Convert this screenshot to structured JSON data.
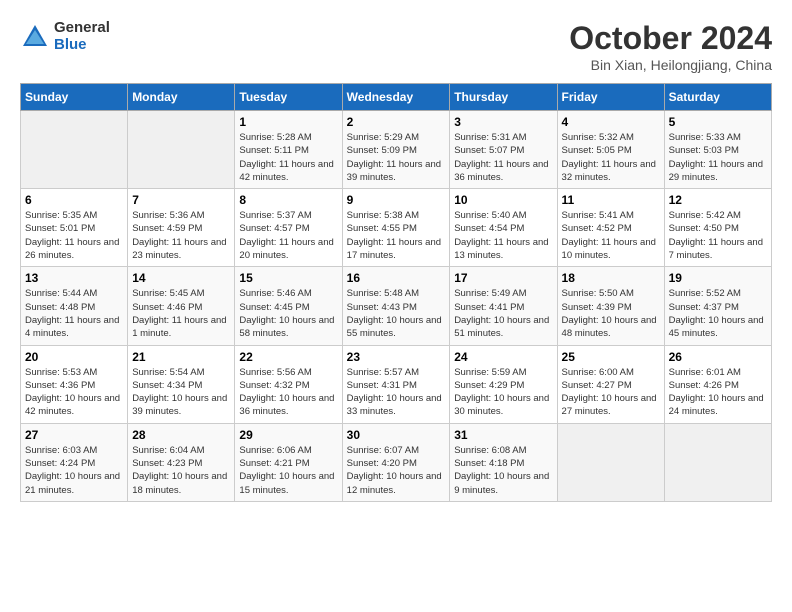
{
  "header": {
    "logo_general": "General",
    "logo_blue": "Blue",
    "month": "October 2024",
    "location": "Bin Xian, Heilongjiang, China"
  },
  "days_of_week": [
    "Sunday",
    "Monday",
    "Tuesday",
    "Wednesday",
    "Thursday",
    "Friday",
    "Saturday"
  ],
  "weeks": [
    [
      {
        "day": "",
        "info": ""
      },
      {
        "day": "",
        "info": ""
      },
      {
        "day": "1",
        "info": "Sunrise: 5:28 AM\nSunset: 5:11 PM\nDaylight: 11 hours and 42 minutes."
      },
      {
        "day": "2",
        "info": "Sunrise: 5:29 AM\nSunset: 5:09 PM\nDaylight: 11 hours and 39 minutes."
      },
      {
        "day": "3",
        "info": "Sunrise: 5:31 AM\nSunset: 5:07 PM\nDaylight: 11 hours and 36 minutes."
      },
      {
        "day": "4",
        "info": "Sunrise: 5:32 AM\nSunset: 5:05 PM\nDaylight: 11 hours and 32 minutes."
      },
      {
        "day": "5",
        "info": "Sunrise: 5:33 AM\nSunset: 5:03 PM\nDaylight: 11 hours and 29 minutes."
      }
    ],
    [
      {
        "day": "6",
        "info": "Sunrise: 5:35 AM\nSunset: 5:01 PM\nDaylight: 11 hours and 26 minutes."
      },
      {
        "day": "7",
        "info": "Sunrise: 5:36 AM\nSunset: 4:59 PM\nDaylight: 11 hours and 23 minutes."
      },
      {
        "day": "8",
        "info": "Sunrise: 5:37 AM\nSunset: 4:57 PM\nDaylight: 11 hours and 20 minutes."
      },
      {
        "day": "9",
        "info": "Sunrise: 5:38 AM\nSunset: 4:55 PM\nDaylight: 11 hours and 17 minutes."
      },
      {
        "day": "10",
        "info": "Sunrise: 5:40 AM\nSunset: 4:54 PM\nDaylight: 11 hours and 13 minutes."
      },
      {
        "day": "11",
        "info": "Sunrise: 5:41 AM\nSunset: 4:52 PM\nDaylight: 11 hours and 10 minutes."
      },
      {
        "day": "12",
        "info": "Sunrise: 5:42 AM\nSunset: 4:50 PM\nDaylight: 11 hours and 7 minutes."
      }
    ],
    [
      {
        "day": "13",
        "info": "Sunrise: 5:44 AM\nSunset: 4:48 PM\nDaylight: 11 hours and 4 minutes."
      },
      {
        "day": "14",
        "info": "Sunrise: 5:45 AM\nSunset: 4:46 PM\nDaylight: 11 hours and 1 minute."
      },
      {
        "day": "15",
        "info": "Sunrise: 5:46 AM\nSunset: 4:45 PM\nDaylight: 10 hours and 58 minutes."
      },
      {
        "day": "16",
        "info": "Sunrise: 5:48 AM\nSunset: 4:43 PM\nDaylight: 10 hours and 55 minutes."
      },
      {
        "day": "17",
        "info": "Sunrise: 5:49 AM\nSunset: 4:41 PM\nDaylight: 10 hours and 51 minutes."
      },
      {
        "day": "18",
        "info": "Sunrise: 5:50 AM\nSunset: 4:39 PM\nDaylight: 10 hours and 48 minutes."
      },
      {
        "day": "19",
        "info": "Sunrise: 5:52 AM\nSunset: 4:37 PM\nDaylight: 10 hours and 45 minutes."
      }
    ],
    [
      {
        "day": "20",
        "info": "Sunrise: 5:53 AM\nSunset: 4:36 PM\nDaylight: 10 hours and 42 minutes."
      },
      {
        "day": "21",
        "info": "Sunrise: 5:54 AM\nSunset: 4:34 PM\nDaylight: 10 hours and 39 minutes."
      },
      {
        "day": "22",
        "info": "Sunrise: 5:56 AM\nSunset: 4:32 PM\nDaylight: 10 hours and 36 minutes."
      },
      {
        "day": "23",
        "info": "Sunrise: 5:57 AM\nSunset: 4:31 PM\nDaylight: 10 hours and 33 minutes."
      },
      {
        "day": "24",
        "info": "Sunrise: 5:59 AM\nSunset: 4:29 PM\nDaylight: 10 hours and 30 minutes."
      },
      {
        "day": "25",
        "info": "Sunrise: 6:00 AM\nSunset: 4:27 PM\nDaylight: 10 hours and 27 minutes."
      },
      {
        "day": "26",
        "info": "Sunrise: 6:01 AM\nSunset: 4:26 PM\nDaylight: 10 hours and 24 minutes."
      }
    ],
    [
      {
        "day": "27",
        "info": "Sunrise: 6:03 AM\nSunset: 4:24 PM\nDaylight: 10 hours and 21 minutes."
      },
      {
        "day": "28",
        "info": "Sunrise: 6:04 AM\nSunset: 4:23 PM\nDaylight: 10 hours and 18 minutes."
      },
      {
        "day": "29",
        "info": "Sunrise: 6:06 AM\nSunset: 4:21 PM\nDaylight: 10 hours and 15 minutes."
      },
      {
        "day": "30",
        "info": "Sunrise: 6:07 AM\nSunset: 4:20 PM\nDaylight: 10 hours and 12 minutes."
      },
      {
        "day": "31",
        "info": "Sunrise: 6:08 AM\nSunset: 4:18 PM\nDaylight: 10 hours and 9 minutes."
      },
      {
        "day": "",
        "info": ""
      },
      {
        "day": "",
        "info": ""
      }
    ]
  ]
}
